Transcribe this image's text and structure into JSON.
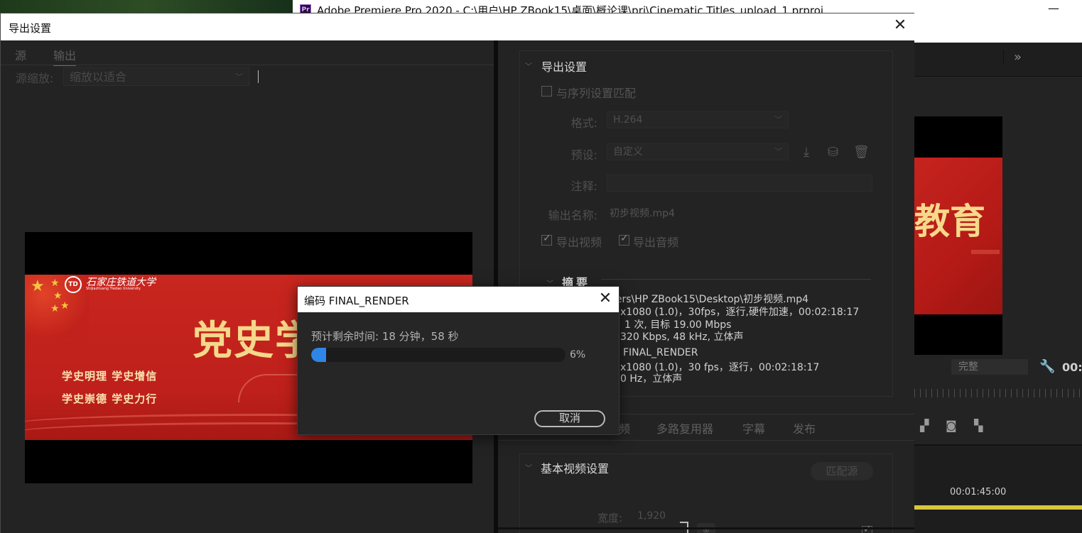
{
  "premiere": {
    "window_title": "Adobe Premiere Pro 2020 - C:\\用户\\HP ZBook15\\桌面\\概论课\\prj\\Cinematic Titles_upload_1.prproj",
    "logo_text": "Pr",
    "minimize_glyph": "—",
    "expand_glyph": "»",
    "preview_banner_text": "教育",
    "quality_value": "完整",
    "wrench_glyph": "🔧",
    "timecode_partial": "00:",
    "timeline_time": "00:01:45:00"
  },
  "export_dialog": {
    "title": "导出设置",
    "close_glyph": "✕",
    "tabs": [
      {
        "label": "源"
      },
      {
        "label": "输出"
      }
    ],
    "source_scale_label": "源缩放:",
    "source_scale_value": "缩放以适合",
    "preview": {
      "school_logo": "TD",
      "school_name_cn": "石家庄铁道大学",
      "school_name_en": "Shijiazhuang Tiedao University",
      "headline": "党史学",
      "slogan_1": "学史明理  学史增信",
      "slogan_2": "学史崇德  学史力行"
    },
    "settings": {
      "section_title": "导出设置",
      "match_sequence_label": "与序列设置匹配",
      "format_label": "格式:",
      "format_value": "H.264",
      "preset_label": "预设:",
      "preset_value": "自定义",
      "comment_label": "注释:",
      "output_name_label": "输出名称:",
      "output_name_value": "初步视频.mp4",
      "export_video_label": "导出视频",
      "export_audio_label": "导出音频",
      "summary_title": "摘要",
      "summary_lines": [
        "输出: C:\\Users\\HP  ZBook15\\Desktop\\初步视频.mp4",
        "x1080 (1.0)，30fps，逐行,硬件加速，00:02:18:17",
        "1 次, 目标 19.00 Mbps",
        "320 Kbps, 48  kHz, 立体声",
        "FINAL_RENDER",
        "x1080 (1.0)，30 fps，逐行，00:02:18:17",
        "0 Hz，立体声"
      ]
    },
    "bottom_tabs": [
      "频",
      "多路复用器",
      "字幕",
      "发布"
    ],
    "basic_video": {
      "section_title": "基本视频设置",
      "match_source_button": "匹配源",
      "width_label": "宽度:",
      "width_value": "1,920",
      "link_glyph": "∞"
    }
  },
  "encode_dialog": {
    "title": "编码 FINAL_RENDER",
    "close_glyph": "✕",
    "time_remaining": "预计剩余时间: 18 分钟，58 秒",
    "progress_percent": 6,
    "progress_label": "6%",
    "cancel_label": "取消"
  },
  "colors": {
    "progress_blue": "#2e86e6",
    "banner_red": "#c8261f",
    "headline_gold": "#f5d88a"
  },
  "icons": {
    "import_preset": "import-preset-icon",
    "save_preset": "save-preset-icon",
    "delete_preset": "trash-icon",
    "camera": "camera-icon"
  }
}
